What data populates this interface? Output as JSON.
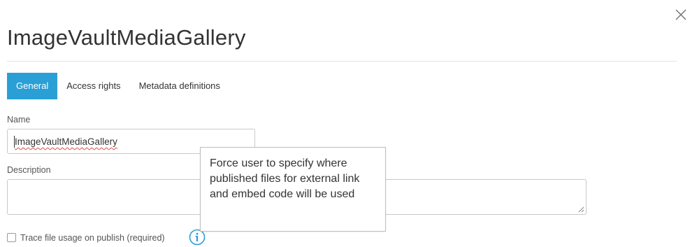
{
  "dialog": {
    "title": "ImageVaultMediaGallery",
    "close_icon": "close-icon"
  },
  "tabs": [
    {
      "label": "General",
      "active": true
    },
    {
      "label": "Access rights",
      "active": false
    },
    {
      "label": "Metadata definitions",
      "active": false
    }
  ],
  "form": {
    "name_label": "Name",
    "name_value": "ImageVaultMediaGallery",
    "description_label": "Description",
    "description_value": "",
    "trace_checkbox_label": "Trace file usage on publish (required)",
    "trace_checked": false,
    "info_icon": "info-icon"
  },
  "tooltip": {
    "text": "Force user to specify where published files for external link and embed code will be used"
  },
  "colors": {
    "accent": "#2a9fd6",
    "info": "#2a9fd6",
    "text": "#333333"
  }
}
